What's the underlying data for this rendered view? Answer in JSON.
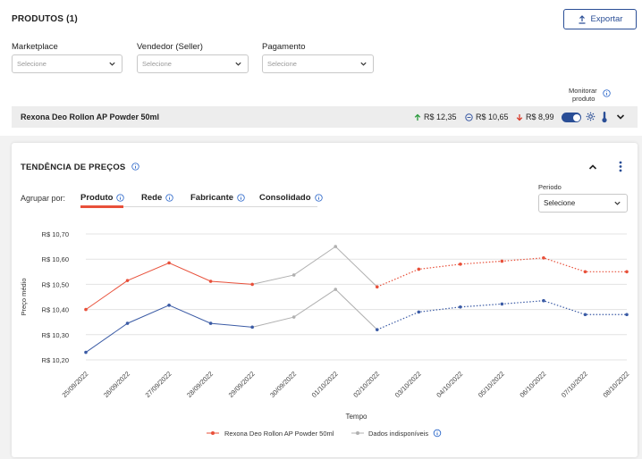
{
  "header": {
    "title": "PRODUTOS (1)",
    "export_label": "Exportar"
  },
  "filters": [
    {
      "label": "Marketplace",
      "placeholder": "Selecione"
    },
    {
      "label": "Vendedor (Seller)",
      "placeholder": "Selecione"
    },
    {
      "label": "Pagamento",
      "placeholder": "Selecione"
    }
  ],
  "monitor": {
    "label_line1": "Monitorar",
    "label_line2": "produto",
    "enabled": true
  },
  "product": {
    "name": "Rexona Deo Rollon AP Powder 50ml",
    "price_max": "R$ 12,35",
    "price_avg": "R$ 10,65",
    "price_min": "R$ 8,99"
  },
  "trend": {
    "title": "TENDÊNCIA DE PREÇOS",
    "group_by_label": "Agrupar por:",
    "tabs": [
      "Produto",
      "Rede",
      "Fabricante",
      "Consolidado"
    ],
    "active_tab": "Produto",
    "period_label": "Periodo",
    "period_value": "Selecione"
  },
  "colors": {
    "accent": "#2a4e96",
    "series_red": "#e8503a",
    "series_blue": "#3b5ba5",
    "unavailable": "#b0b0b0"
  },
  "chart_data": {
    "type": "line",
    "xlabel": "Tempo",
    "ylabel": "Preço médio",
    "ylim": [
      10.2,
      10.7
    ],
    "yticks": [
      "R$ 10,70",
      "R$ 10,60",
      "R$ 10,50",
      "R$ 10,40",
      "R$ 10,30",
      "R$ 10,20"
    ],
    "ytick_values": [
      10.7,
      10.6,
      10.5,
      10.4,
      10.3,
      10.2
    ],
    "categories": [
      "25/09/2022",
      "26/09/2022",
      "27/09/2022",
      "28/09/2022",
      "29/09/2022",
      "30/09/2022",
      "01/10/2022",
      "02/10/2022",
      "03/10/2022",
      "04/10/2022",
      "05/10/2022",
      "06/10/2022",
      "07/10/2022",
      "08/10/2022"
    ],
    "series": [
      {
        "values": [
          10.4,
          10.515,
          10.585,
          10.512,
          10.5,
          10.537,
          10.65,
          10.49,
          10.56,
          10.58,
          10.592,
          10.605,
          10.55,
          10.55
        ],
        "color": "#e8503a"
      },
      {
        "values": [
          10.23,
          10.345,
          10.417,
          10.345,
          10.33,
          10.37,
          10.48,
          10.32,
          10.39,
          10.41,
          10.422,
          10.435,
          10.38,
          10.38
        ],
        "color": "#3b5ba5"
      }
    ],
    "segments": {
      "solid": [
        0,
        4
      ],
      "unavailable": [
        4,
        7
      ],
      "dotted": [
        7,
        13
      ]
    },
    "legend": [
      {
        "label": "Rexona Deo Rollon AP Powder 50ml",
        "color": "#e8503a"
      },
      {
        "label": "Dados indisponíveis",
        "color": "#b0b0b0"
      }
    ],
    "legend_position": "bottom",
    "grid": true
  }
}
